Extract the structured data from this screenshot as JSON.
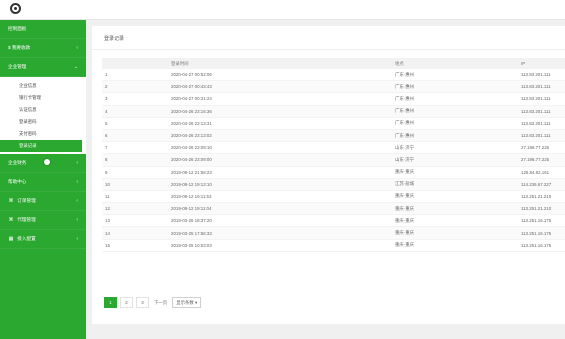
{
  "sidebar": {
    "items": [
      {
        "label": "控制面板",
        "chev": ""
      },
      {
        "label": "$ 我要收款",
        "chev": "‹"
      },
      {
        "label": "企业管理",
        "chev": "⌄"
      }
    ],
    "submenu": [
      "企业信息",
      "银行卡管理",
      "认证信息",
      "登录密码",
      "支付密码",
      "登录记录"
    ],
    "items_after": [
      {
        "label": "企业财务",
        "chev": "‹"
      },
      {
        "label": "帮助中心",
        "chev": "‹"
      },
      {
        "label": "订单管理",
        "chev": "‹",
        "icon": "⌘"
      },
      {
        "label": "代理管理",
        "chev": "‹",
        "icon": "⌘"
      },
      {
        "label": "接入配置",
        "chev": "‹",
        "icon": "▦"
      }
    ]
  },
  "main": {
    "title": "登录记录",
    "columns": [
      "",
      "登录时间",
      "地点",
      "IP"
    ],
    "rows": [
      [
        "1",
        "2020-04-27 00:52:06",
        "广东·惠州",
        "113.83.201.111"
      ],
      [
        "2",
        "2020-04-27 00:43:43",
        "广东·惠州",
        "113.83.201.111"
      ],
      [
        "3",
        "2020-04-27 00:31:24",
        "广东·惠州",
        "113.83.201.111"
      ],
      [
        "4",
        "2020-04-26 23:16:36",
        "广东·惠州",
        "113.83.201.111"
      ],
      [
        "5",
        "2020-04-26 23:13:31",
        "广东·惠州",
        "113.83.201.111"
      ],
      [
        "6",
        "2020-04-26 23:13:02",
        "广东·惠州",
        "113.83.201.111"
      ],
      [
        "7",
        "2020-04-26 23:09:10",
        "山东·济宁",
        "27.198.77.225"
      ],
      [
        "8",
        "2020-04-26 23:09:00",
        "山东·济宁",
        "27.198.77.225"
      ],
      [
        "9",
        "2019-09-12 21:58:23",
        "重庆·重庆",
        "125.84.82.161"
      ],
      [
        "10",
        "2019-09-12 19:13:10",
        "江苏·盐城",
        "114.236.67.227"
      ],
      [
        "11",
        "2019-09-12 19:11:53",
        "重庆·重庆",
        "113.251.21.210"
      ],
      [
        "12",
        "2019-09-12 19:11:04",
        "重庆·重庆",
        "113.251.21.210"
      ],
      [
        "13",
        "2019-03-25 18:37:20",
        "重庆·重庆",
        "113.251.16.175"
      ],
      [
        "14",
        "2019-03-25 17:56:33",
        "重庆·重庆",
        "113.251.16.175"
      ],
      [
        "15",
        "2019-03-25 10:53:03",
        "重庆·重庆",
        "113.251.16.175"
      ]
    ]
  },
  "pager": {
    "pages": [
      "1",
      "2",
      "3"
    ],
    "next": "下一页",
    "page_size": "显示条数 ▾"
  },
  "colors": {
    "accent": "#2aa82f"
  }
}
